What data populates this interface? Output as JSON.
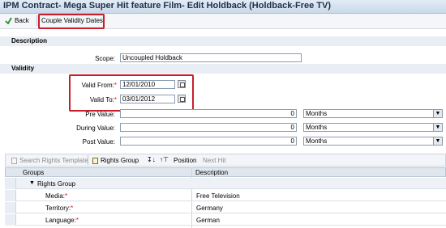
{
  "window": {
    "title": "IPM  Contract- Mega Super Hit feature Film- Edit Holdback (Holdback-Free TV)"
  },
  "toolbar": {
    "back_label": "Back",
    "couple_label": "Couple Validity Dates"
  },
  "description_section": {
    "header": "Description",
    "scope_label": "Scope:",
    "scope_value": "Uncoupled Holdback"
  },
  "validity_section": {
    "header": "Validity",
    "valid_from_label": "Valid From:",
    "valid_from_value": "12/01/2010",
    "valid_to_label": "Valid To:",
    "valid_to_value": "03/01/2012",
    "pre_label": "Pre Value:",
    "pre_value": "0",
    "pre_unit": "Months",
    "during_label": "During Value:",
    "during_value": "0",
    "during_unit": "Months",
    "post_label": "Post Value:",
    "post_value": "0",
    "post_unit": "Months",
    "required_mark": "*"
  },
  "table_toolbar": {
    "search_label": "Search Rights Template",
    "rights_group_label": "Rights Group",
    "position_label": "Position",
    "next_hit_label": "Next Hit"
  },
  "table": {
    "columns": [
      "Groups",
      "Description"
    ],
    "group_row": "Rights Group",
    "rows": [
      {
        "label": "Media:",
        "value": "Free Television"
      },
      {
        "label": "Territory:",
        "value": "Germany"
      },
      {
        "label": "Language:",
        "value": "German"
      }
    ]
  },
  "colors": {
    "highlight": "#c8202b",
    "titlebar": "#c9d9e8"
  }
}
